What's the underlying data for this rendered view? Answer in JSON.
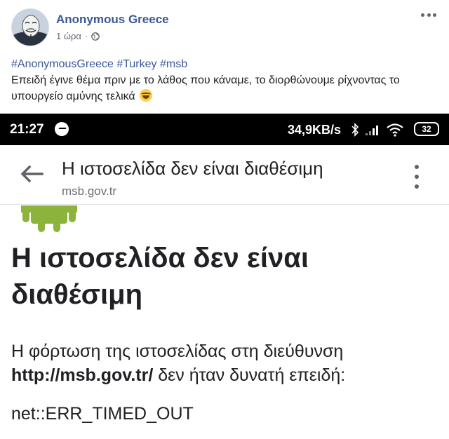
{
  "post": {
    "author": "Anonymous Greece",
    "time": "1 ώρα",
    "hashtags": [
      "#AnonymousGreece",
      "#Turkey",
      "#msb"
    ],
    "text": "Επειδή έγινε θέμα πριν με το λάθος που κάναμε, το διορθώνουμε ρίχνοντας το υπουργείο αμύνης τελικά",
    "emoji": "laughing-face-icon"
  },
  "phone": {
    "status_bar": {
      "time": "21:27",
      "speed": "34,9KB/s",
      "battery": "32"
    },
    "browser": {
      "title": "Η ιστοσελίδα δεν είναι διαθέσιμη",
      "url": "msb.gov.tr"
    },
    "error": {
      "heading": "Η ιστοσελίδα δεν είναι διαθέσιμη",
      "body_prefix": "Η φόρτωση της ιστοσελίδας στη διεύθυνση",
      "body_url": "http://msb.gov.tr/",
      "body_suffix": "δεν ήταν δυνατή επειδή:",
      "code": "net::ERR_TIMED_OUT"
    }
  },
  "colors": {
    "link": "#385898",
    "android_green": "#8cb43d",
    "status_bar": "#000000"
  }
}
